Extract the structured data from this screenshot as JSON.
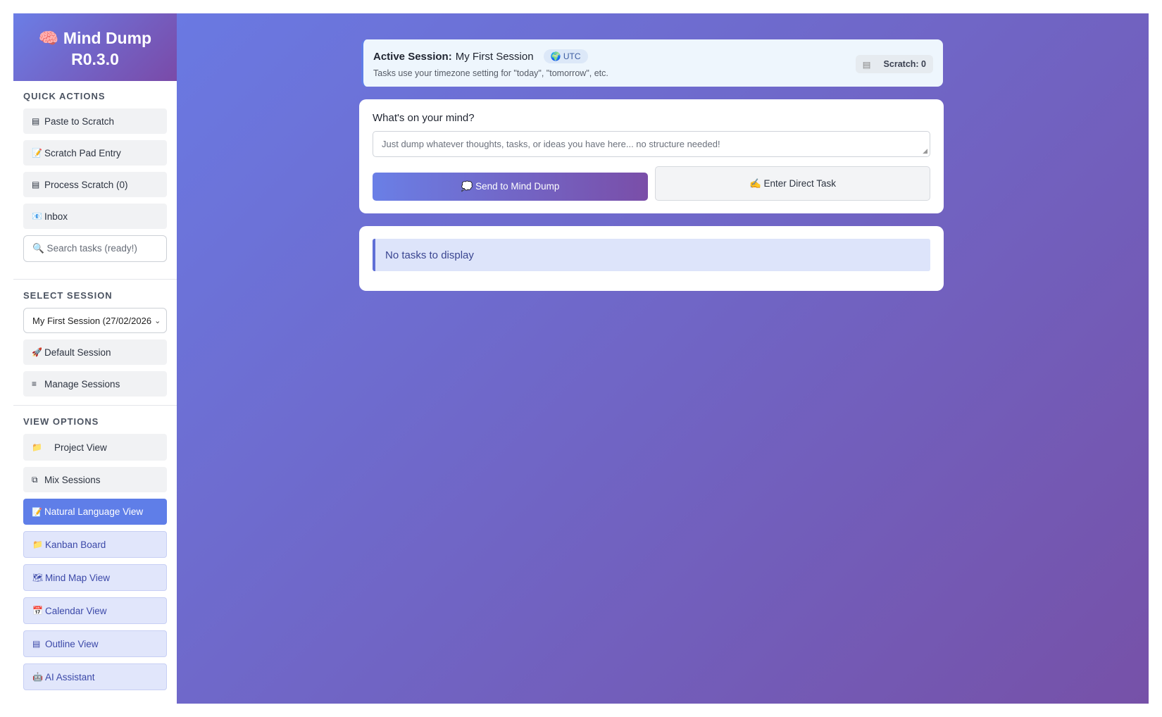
{
  "sidebar": {
    "brand": {
      "icon": "🧠",
      "title": "Mind Dump",
      "version": "R0.3.0"
    },
    "quick_actions": {
      "title": "Quick Actions",
      "items": [
        {
          "icon": "▤",
          "label": "Paste to Scratch"
        },
        {
          "icon": "📝",
          "label": "Scratch Pad Entry"
        },
        {
          "icon": "▤",
          "label": "Process Scratch (0)"
        },
        {
          "icon": "📧",
          "label": "Inbox"
        }
      ],
      "search_placeholder": "🔍 Search tasks (ready!)"
    },
    "select_session": {
      "title": "Select Session",
      "selected": "My First Session (27/02/2026",
      "items": [
        {
          "icon": "🚀",
          "label": "Default Session"
        },
        {
          "icon": "≡",
          "label": "Manage Sessions"
        }
      ]
    },
    "view_options": {
      "title": "View Options",
      "items": [
        {
          "icon": "📁",
          "label": "Project View"
        },
        {
          "icon": "⧉",
          "label": "Mix Sessions"
        },
        {
          "icon": "📝",
          "label": "Natural Language View"
        },
        {
          "icon": "📁",
          "label": "Kanban Board"
        },
        {
          "icon": "🗺",
          "label": "Mind Map View"
        },
        {
          "icon": "📅",
          "label": "Calendar View"
        },
        {
          "icon": "▤",
          "label": "Outline View"
        },
        {
          "icon": "🤖",
          "label": "AI Assistant"
        }
      ]
    }
  },
  "session_bar": {
    "label": "Active Session:",
    "name": "My First Session",
    "timezone": "🌍 UTC",
    "note": "Tasks use your timezone setting for \"today\", \"tomorrow\", etc.",
    "scratch_icon": "▤",
    "scratch_label": "Scratch: 0"
  },
  "dump_card": {
    "prompt": "What's on your mind?",
    "placeholder": "Just dump whatever thoughts, tasks, or ideas you have here... no structure needed!",
    "send_label": "💭 Send to Mind Dump",
    "direct_label": "✍️ Enter Direct Task"
  },
  "tasks_card": {
    "empty_message": "No tasks to display"
  },
  "colors": {
    "accent": "#5f7ee8",
    "gradient_start": "#6a79e2",
    "gradient_end": "#7651a8"
  }
}
